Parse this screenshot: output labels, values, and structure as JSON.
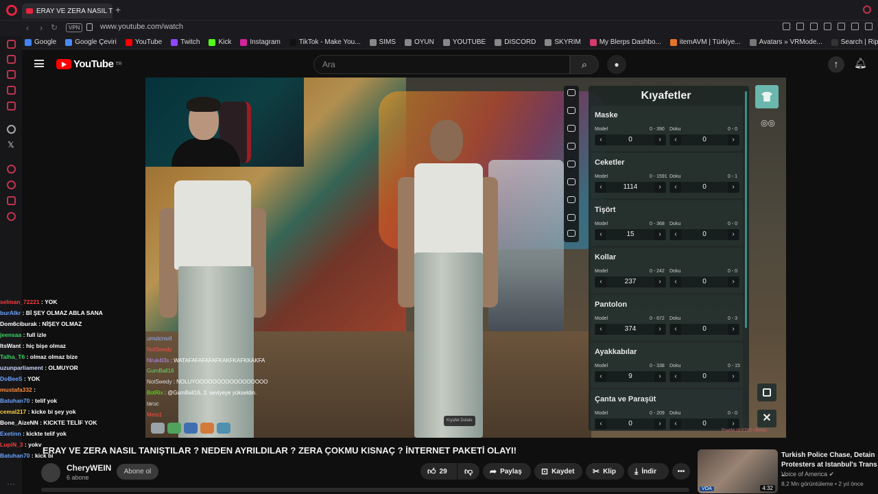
{
  "browser": {
    "tab_title": "ERAY VE ZERA NASIL TANIŞTILAR",
    "new_tab": "+",
    "url": "www.youtube.com/watch",
    "vpn": "VPN",
    "bookmarks": [
      {
        "label": "Google",
        "color": "#4285f4"
      },
      {
        "label": "Google Çeviri",
        "color": "#4a8af4"
      },
      {
        "label": "YouTube",
        "color": "#ff0000"
      },
      {
        "label": "Twitch",
        "color": "#9146ff"
      },
      {
        "label": "Kick",
        "color": "#53fc18"
      },
      {
        "label": "Instagram",
        "color": "#d6249f"
      },
      {
        "label": "TikTok - Make You...",
        "color": "#111111"
      },
      {
        "label": "SIMS",
        "color": "#888888"
      },
      {
        "label": "OYUN",
        "color": "#888888"
      },
      {
        "label": "YOUTUBE",
        "color": "#888888"
      },
      {
        "label": "DISCORD",
        "color": "#888888"
      },
      {
        "label": "SKYRIM",
        "color": "#888888"
      },
      {
        "label": "My Blerps Dashbo...",
        "color": "#d23b6a"
      },
      {
        "label": "itemAVM | Türkiye...",
        "color": "#e5732b"
      },
      {
        "label": "Avatars » VRMode...",
        "color": "#777777"
      },
      {
        "label": "Search | RipperSt...",
        "color": "#333333"
      }
    ]
  },
  "youtube": {
    "logo_text": "YouTube",
    "logo_region": "TR",
    "search_placeholder": "Ara"
  },
  "game": {
    "panel_title": "Kıyafetler",
    "model_label": "Model",
    "texture_label": "Doku",
    "categories": [
      {
        "name": "Maske",
        "model_range": "0 - 390",
        "texture_range": "0 - 0",
        "model": "0",
        "texture": "0"
      },
      {
        "name": "Ceketler",
        "model_range": "0 - 1591",
        "texture_range": "0 - 1",
        "model": "1114",
        "texture": "0"
      },
      {
        "name": "Tişört",
        "model_range": "0 - 368",
        "texture_range": "0 - 0",
        "model": "15",
        "texture": "0"
      },
      {
        "name": "Kollar",
        "model_range": "0 - 242",
        "texture_range": "0 - 0",
        "model": "237",
        "texture": "0"
      },
      {
        "name": "Pantolon",
        "model_range": "0 - 672",
        "texture_range": "0 - 3",
        "model": "374",
        "texture": "0"
      },
      {
        "name": "Ayakkabılar",
        "model_range": "0 - 338",
        "texture_range": "0 - 15",
        "model": "9",
        "texture": "0"
      },
      {
        "name": "Çanta ve Paraşüt",
        "model_range": "0 - 209",
        "texture_range": "0 - 0",
        "model": "0",
        "texture": "0"
      }
    ],
    "outfit_pill": "Kıyafet Dolabı",
    "watermark": "FiveM (b3095) (Beta)",
    "ingame_chat": [
      {
        "user": "umutcnsril",
        "msg": "",
        "color": "#8fb3ff"
      },
      {
        "user": "NotSwedy",
        "msg": "",
        "color": "#ff4b4b"
      },
      {
        "user": "f4ruk4l3s",
        "msg": ": WATAFAFAFAFAFKAKFKAFKKAKFA",
        "color": "#b58cff"
      },
      {
        "user": "GumBall16",
        "msg": "",
        "color": "#6bdc6b"
      },
      {
        "user": "NotSwedy",
        "msg": ": NOLUYOOOOOOOOOOOOOOOOO",
        "color": "#dddddd"
      },
      {
        "user": "BotRix",
        "msg": ": @GumBall16, 3. seviyeye yükseldin.",
        "color": "#53fc18"
      },
      {
        "user": "taruc",
        "msg": "",
        "color": "#dddddd"
      },
      {
        "user": "Meto1",
        "msg": "",
        "color": "#ff4b4b"
      }
    ]
  },
  "stream_chat": [
    {
      "user": "selman_72221",
      "msg": ": YOK",
      "color": "#ff3b3b"
    },
    {
      "user": "burAlkr",
      "msg": ": Bİ ŞEY OLMAZ ABLA SANA",
      "color": "#6aa4ff"
    },
    {
      "user": "Dom6ciburak",
      "msg": ": NİŞEY OLMAZ",
      "color": "#ffffff"
    },
    {
      "user": "jeensaa",
      "msg": ": full izle",
      "color": "#3bd55f"
    },
    {
      "user": "ItsWant",
      "msg": ": hiç bişe olmaz",
      "color": "#ffffff"
    },
    {
      "user": "Talha_T6",
      "msg": ": olmaz olmaz bize",
      "color": "#3bd55f"
    },
    {
      "user": "uzunparliament",
      "msg": ": OLMUYOR",
      "color": "#cfd8ff"
    },
    {
      "user": "DoBeeS",
      "msg": ": YOK",
      "color": "#6aa4ff"
    },
    {
      "user": "mustafa332",
      "msg": ":",
      "color": "#ff8c3b"
    },
    {
      "user": "Batuhan70",
      "msg": ": telif yok",
      "color": "#6aa4ff"
    },
    {
      "user": "cemal217",
      "msg": ": kicke bi şey yok",
      "color": "#ffd23b"
    },
    {
      "user": "Bone_AizeNN",
      "msg": ": KICKTE TELİF YOK",
      "color": "#ffffff"
    },
    {
      "user": "Exetinn",
      "msg": ": kickte telif yok",
      "color": "#6aa4ff"
    },
    {
      "user": "LupiN_3",
      "msg": ": yokv",
      "color": "#ff3b3b"
    },
    {
      "user": "Batuhan70",
      "msg": ": kick bi",
      "color": "#6aa4ff"
    }
  ],
  "video": {
    "title": "ERAY VE ZERA NASIL TANIŞTILAR ? NEDEN AYRILDILAR ? ZERA ÇOKMU KISNAÇ ? İNTERNET PAKETİ OLAYI!",
    "channel": "CheryWEIN",
    "subscribers": "6 abone",
    "subscribe": "Abone ol",
    "likes": "29",
    "share": "Paylaş",
    "save": "Kaydet",
    "clip": "Klip",
    "download": "İndir",
    "more": "•••"
  },
  "recommended": {
    "title": "Turkish Police Chase, Detain Protesters at Istanbul's Trans ...",
    "channel": "Voice of America",
    "views": "8,2 Mn görüntüleme",
    "age": "2 yıl önce",
    "duration": "4:32",
    "badge": "VOA"
  }
}
